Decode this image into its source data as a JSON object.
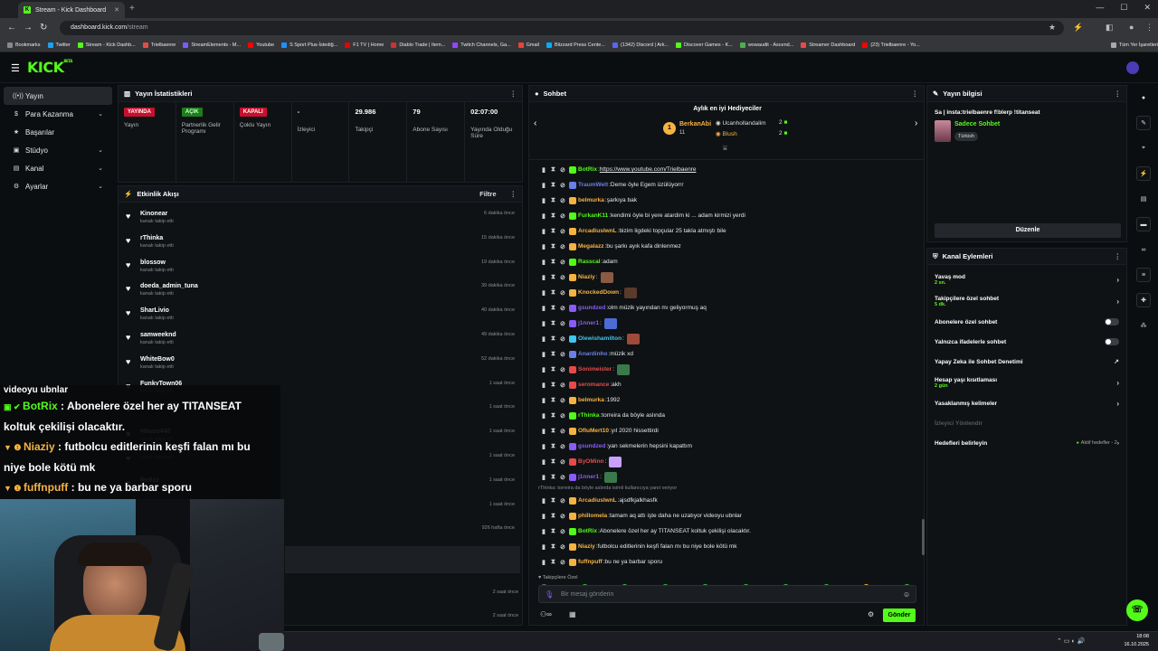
{
  "browser": {
    "tab_title": "Stream - Kick Dashboard",
    "url_host": "dashboard.kick.com",
    "url_path": "/stream",
    "bookmarks": [
      "Bookmarks",
      "Twitter",
      "Stream - Kick Dashb...",
      "Trielbaenre",
      "StreamElements - M...",
      "Youtube",
      "S Sport Plus-İstediğ...",
      "F1 TV | Home",
      "Diablo Trade | Item...",
      "Twitch Channels, Ga...",
      "Gmail",
      "Blizzard Press Cente...",
      "(1342) Discord | Ark...",
      "Discover Games - K...",
      "wowaudit - Ascend...",
      "Streamer Dashboard",
      "(23) Trielbaenre - Yo...",
      "Tüm Yer İşaretleri"
    ]
  },
  "kick": {
    "logo": "KICK",
    "logo_sup": "BETA"
  },
  "nav": {
    "items": [
      {
        "label": "Yayın"
      },
      {
        "label": "Para Kazanma"
      },
      {
        "label": "Başarılar"
      },
      {
        "label": "Stüdyo"
      },
      {
        "label": "Kanal"
      },
      {
        "label": "Ayarlar"
      }
    ]
  },
  "stats": {
    "title": "Yayın İstatistikleri",
    "cells": [
      {
        "value_badge": "YAYINDA",
        "label": "Yayın"
      },
      {
        "value_badge": "AÇIK",
        "label": "Partnerlik Gelir Programı"
      },
      {
        "value_badge": "KAPALI",
        "label": "Çoklu Yayın"
      },
      {
        "value": "-",
        "label": "İzleyici"
      },
      {
        "value": "29.986",
        "label": "Takipçi"
      },
      {
        "value": "79",
        "label": "Abone Sayısı"
      },
      {
        "value": "02:07:00",
        "label": "Yayında Olduğu Süre"
      }
    ]
  },
  "activity": {
    "title": "Etkinlik Akışı",
    "filter": "Filtre",
    "items": [
      {
        "name": "Kinonear",
        "sub": "kanalı takip etti",
        "time": "6 dakika önce"
      },
      {
        "name": "rThinka",
        "sub": "kanalı takip etti",
        "time": "15 dakika önce"
      },
      {
        "name": "blossow",
        "sub": "kanalı takip etti",
        "time": "19 dakika önce"
      },
      {
        "name": "doeda_admin_tuna",
        "sub": "kanalı takip etti",
        "time": "39 dakika önce"
      },
      {
        "name": "SharLivio",
        "sub": "kanalı takip etti",
        "time": "40 dakika önce"
      },
      {
        "name": "samweeknd",
        "sub": "kanalı takip etti",
        "time": "49 dakika önce"
      },
      {
        "name": "WhiteBow0",
        "sub": "kanalı takip etti",
        "time": "52 dakika önce"
      },
      {
        "name": "FunkyTown06",
        "sub": "kanalı takip etti",
        "time": "1 saat önce"
      },
      {
        "name": "",
        "sub": "",
        "time": "1 saat önce"
      },
      {
        "name": "Hhuso448",
        "sub": "kanalı takip etti",
        "time": "1 saat önce"
      },
      {
        "name": "",
        "sub": "kanalı takip etti",
        "time": "1 saat önce"
      },
      {
        "name": "feritxz",
        "sub": "",
        "time": "1 saat önce"
      },
      {
        "name": "",
        "sub": "",
        "time": "1 saat önce"
      },
      {
        "name": "",
        "sub": "",
        "time": "926 hafta önce"
      }
    ],
    "extra_times": [
      "2 saat önce",
      "2 saat önce"
    ]
  },
  "chat": {
    "title": "Sohbet",
    "gifters_title": "Aylık en iyi Hediyeciler",
    "gifters": [
      {
        "rank": "1",
        "name": "BerkanAbi",
        "count": "11"
      },
      {
        "name": "Ucanhollandalim",
        "count": "2"
      },
      {
        "name": "Blush",
        "count": "2"
      }
    ],
    "messages": [
      {
        "user": "BotRix",
        "color": "#53fc18",
        "text": " https://www.youtube.com/Trielbaenre"
      },
      {
        "user": "TraumWelt",
        "color": "#6c7ee8",
        "text": " Deme öyle Egem üzülüyorrr"
      },
      {
        "user": "belmurka",
        "color": "#f5b342",
        "text": " şarkıya bak"
      },
      {
        "user": "FurkanK11",
        "color": "#53fc18",
        "text": " kendimi öyle bi yere atardim ki ... adam kirmizi yerdi"
      },
      {
        "user": "ArcadiuslwnL",
        "color": "#f5b342",
        "text": " bizim ligdeki topçular 25 takla atmıştı bile"
      },
      {
        "user": "Megalazz",
        "color": "#f5b342",
        "text": " bu şarkı ayık kafa dinlenmez"
      },
      {
        "user": "Rasscal",
        "color": "#53fc18",
        "text": " adam"
      },
      {
        "user": "Niaziy",
        "color": "#f5b342",
        "text": ""
      },
      {
        "user": "KnockedDown",
        "color": "#f5b342",
        "text": ""
      },
      {
        "user": "gsundzed",
        "color": "#8a5cf6",
        "text": " olm müzik yayından mı geliyormuş aq"
      },
      {
        "user": "j1nner1",
        "color": "#8a5cf6",
        "text": ""
      },
      {
        "user": "Olewishamilton",
        "color": "#3ec7f0",
        "text": ""
      },
      {
        "user": "Anardinho",
        "color": "#6c7ee8",
        "text": " müzik xd"
      },
      {
        "user": "Sonimeister",
        "color": "#e84a4a",
        "text": ""
      },
      {
        "user": "seromance",
        "color": "#e84a4a",
        "text": " akh"
      },
      {
        "user": "belmurka",
        "color": "#f5b342",
        "text": " 1992"
      },
      {
        "user": "rThinka",
        "color": "#53fc18",
        "text": " torreira da böyle aslında"
      },
      {
        "user": "OfluMert10",
        "color": "#f5b342",
        "text": " yıl 2020 hissettirdi"
      },
      {
        "user": "gsundzed",
        "color": "#8a5cf6",
        "text": " yan sekmelerin hepsini kapattım"
      },
      {
        "user": "ByOMinn",
        "color": "#e84a4a",
        "text": ""
      },
      {
        "user": "j1nner1",
        "color": "#8a5cf6",
        "text": ""
      }
    ],
    "reply_note": "rThinka: torreira da böyle aslında isimli kullanıcıya yanıt veriyor",
    "messages2": [
      {
        "user": "ArcadiuslwnL",
        "color": "#f5b342",
        "text": " ajsdfkjalkhasfk"
      },
      {
        "user": "phillomela",
        "color": "#f5b342",
        "text": " tamam aq attı işte daha ne uzatıyor videoyu ubnlar"
      },
      {
        "user": "BotRix",
        "color": "#53fc18",
        "text": " Abonelere özel her ay TITANSEAT koltuk çekilişi olacaktır."
      },
      {
        "user": "Niaziy",
        "color": "#f5b342",
        "text": " futbolcu editlerinin keşfi falan mı bu niye bole kötü mk"
      },
      {
        "user": "fuffnpuff",
        "color": "#f5b342",
        "text": " bu ne ya barbar sporu"
      }
    ],
    "followers_only": "Takipçilere Özel",
    "input_placeholder": "Bir mesaj gönderin",
    "send": "Gönder"
  },
  "streaminfo": {
    "title": "Yayın bilgisi",
    "stream_title": "Sa | insta:trielbaenre f!blerp !titanseat",
    "category": "Sadece Sohbet",
    "language": "Türkish",
    "edit": "Düzenle"
  },
  "channelactions": {
    "title": "Kanal Eylemleri",
    "items": [
      {
        "label": "Yavaş mod",
        "sub": "2 sn.",
        "kind": "chev"
      },
      {
        "label": "Takipçilere özel sohbet",
        "sub": "5 dk.",
        "kind": "chev"
      },
      {
        "label": "Abonelere özel sohbet",
        "sub": "",
        "kind": "toggle"
      },
      {
        "label": "Yalnızca ifadelerle sohbet",
        "sub": "",
        "kind": "toggle"
      },
      {
        "label": "Yapay Zeka ile Sohbet Denetimi",
        "sub": "",
        "kind": "link"
      },
      {
        "label": "Hesap yaşı kısıtlaması",
        "sub": "2 gün",
        "kind": "chev"
      },
      {
        "label": "Yasaklanmış kelimeler",
        "sub": "",
        "kind": "chev"
      },
      {
        "label": "İzleyici Yönlendir",
        "sub": "",
        "kind": "dim"
      },
      {
        "label": "Hedefleri belirleyin",
        "sub": "",
        "kind": "goals"
      }
    ],
    "goals_status": "Aktif hedefler - 2"
  },
  "overlay": {
    "lines": [
      {
        "user": "",
        "text": "videoyu ubnlar"
      },
      {
        "user": "BotRix",
        "text": " : Abonelere özel her ay TITANSEAT"
      },
      {
        "user": "",
        "text": "koltuk çekilişi olacaktır."
      },
      {
        "user": "Niaziy",
        "text": " : futbolcu editlerinin keşfi falan mı bu"
      },
      {
        "user": "",
        "text": "niye bole kötü mk"
      },
      {
        "user": "fuffnpuff",
        "text": " : bu ne ya barbar sporu"
      }
    ]
  },
  "taskbar": {
    "time": "18:08",
    "date": "16.10.2025"
  },
  "colors": {
    "accent": "#53fc18",
    "live_red": "#c8102e"
  }
}
